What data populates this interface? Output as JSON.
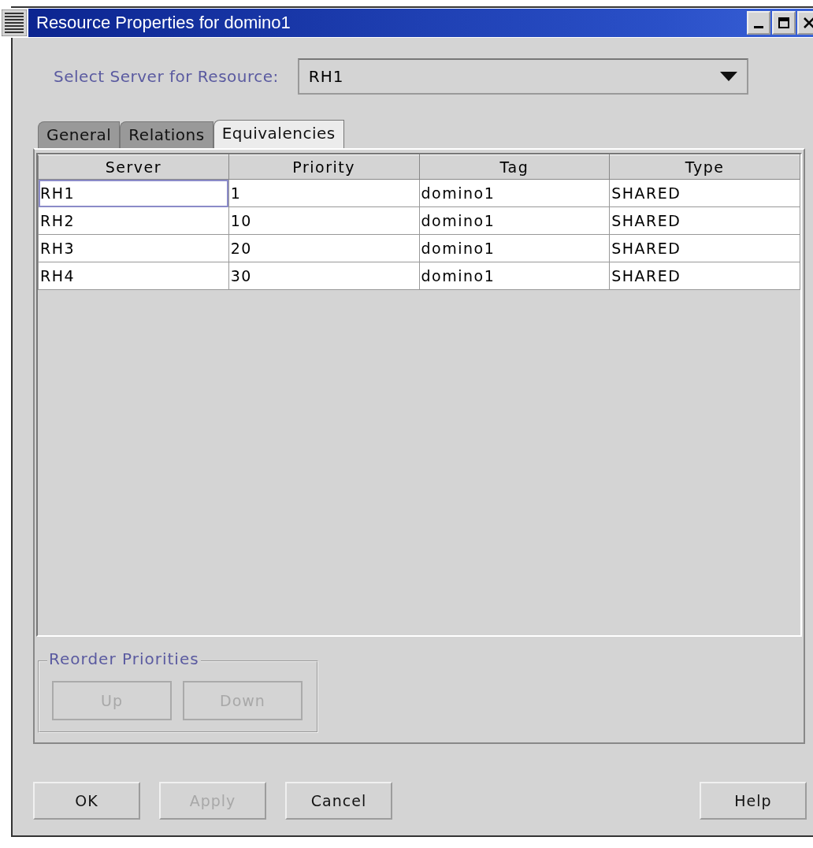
{
  "window": {
    "title": "Resource Properties for domino1"
  },
  "server_select": {
    "label": "Select Server for Resource:",
    "value": "RH1"
  },
  "tabs": [
    {
      "label": "General",
      "selected": false
    },
    {
      "label": "Relations",
      "selected": false
    },
    {
      "label": "Equivalencies",
      "selected": true
    }
  ],
  "table": {
    "columns": [
      "Server",
      "Priority",
      "Tag",
      "Type"
    ],
    "rows": [
      {
        "cells": [
          "RH1",
          "1",
          "domino1",
          "SHARED"
        ],
        "focused": true
      },
      {
        "cells": [
          "RH2",
          "10",
          "domino1",
          "SHARED"
        ],
        "focused": false
      },
      {
        "cells": [
          "RH3",
          "20",
          "domino1",
          "SHARED"
        ],
        "focused": false
      },
      {
        "cells": [
          "RH4",
          "30",
          "domino1",
          "SHARED"
        ],
        "focused": false
      }
    ]
  },
  "reorder": {
    "title": "Reorder Priorities",
    "buttons": [
      {
        "label": "Up",
        "disabled": true
      },
      {
        "label": "Down",
        "disabled": true
      }
    ]
  },
  "buttons": [
    {
      "label": "OK",
      "disabled": false
    },
    {
      "label": "Apply",
      "disabled": true
    },
    {
      "label": "Cancel",
      "disabled": false
    },
    {
      "label": "Help",
      "disabled": false
    }
  ]
}
